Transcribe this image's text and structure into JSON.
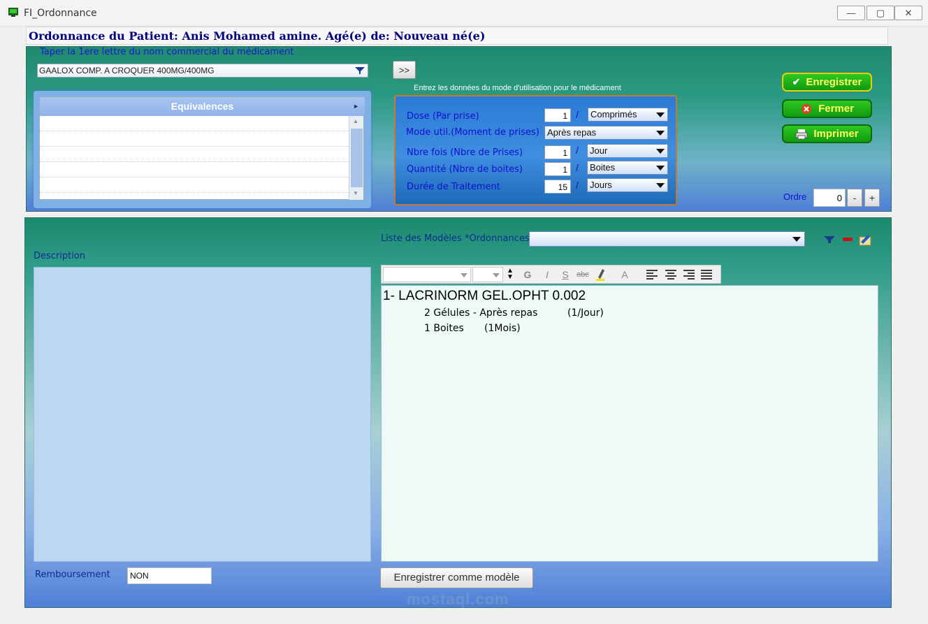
{
  "window": {
    "title": "FI_Ordonnance"
  },
  "header": {
    "patient_line": "Ordonnance du Patient: Anis Mohamed amine. Agé(e) de: Nouveau né(e)"
  },
  "search": {
    "hint": "Taper la 1ere lettre du nom commercial du médicament",
    "value": "GAALOX COMP. A CROQUER 400MG/400MG"
  },
  "add_button": ">>",
  "equivalences": {
    "header": "Equivalences"
  },
  "dosage": {
    "note": "Entrez les données du mode d'utilisation pour le médicament",
    "dose_label": "Dose (Par prise)",
    "dose_value": "1",
    "dose_unit": "Comprimés",
    "mode_label": "Mode util.(Moment de prises)",
    "mode_value": "Après repas",
    "nbre_label": "Nbre fois (Nbre de Prises)",
    "nbre_value": "1",
    "nbre_unit": "Jour",
    "qty_label": "Quantité (Nbre de boites)",
    "qty_value": "1",
    "qty_unit": "Boites",
    "duree_label": "Durée de Traitement",
    "duree_value": "15",
    "duree_unit": "Jours",
    "slash": "/"
  },
  "actions": {
    "save": "Enregistrer",
    "close": "Fermer",
    "print": "Imprimer"
  },
  "ordre": {
    "label": "Ordre",
    "value": "0",
    "minus": "-",
    "plus": "+"
  },
  "models": {
    "label": "Liste des Modèles *Ordonnances"
  },
  "description": {
    "label": "Description"
  },
  "toolbar": {
    "bold": "G",
    "italic": "I",
    "strike": "S",
    "abc": "abc",
    "font_color": "A"
  },
  "prescription": {
    "line1": "1- LACRINORM GEL.OPHT 0.002",
    "line2a": "2 Gélules - Après repas",
    "line2b": "(1/Jour)",
    "line3a": "1 Boites",
    "line3b": "(1Mois)"
  },
  "reimbursement": {
    "label": "Remboursement",
    "value": "NON"
  },
  "save_model_button": "Enregistrer comme modèle",
  "watermark": "mostaql.com",
  "colors": {
    "accent_green": "#119a10",
    "label_blue": "#1010d0",
    "panel_teal": "#1f8a6f"
  }
}
